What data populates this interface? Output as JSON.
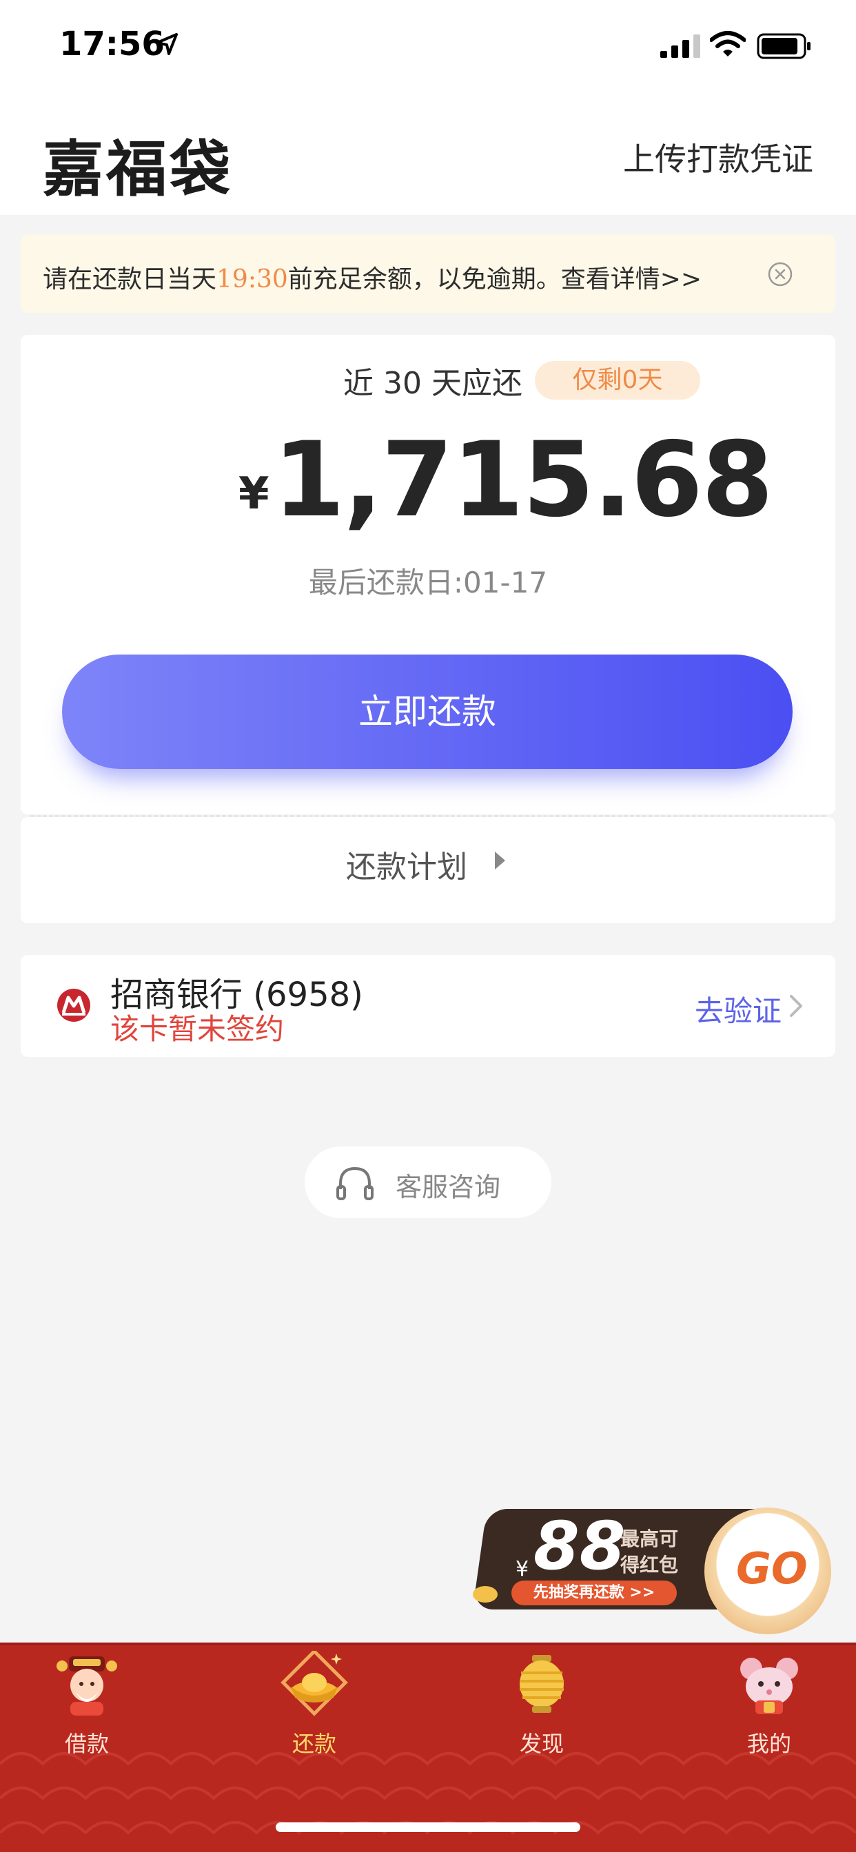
{
  "status_bar": {
    "time": "17:56"
  },
  "header": {
    "title": "嘉福袋",
    "upload_link": "上传打款凭证"
  },
  "notice": {
    "text_before": "请在还款日当天",
    "highlight_time": "19:30",
    "text_after": "前充足余额，以免逾期。查看详情>>"
  },
  "repayment": {
    "due_label": "近 30 天应还",
    "remaining_badge": "仅剩0天",
    "currency_symbol": "¥",
    "amount": "1,715.68",
    "last_date": "最后还款日:01-17",
    "pay_button": "立即还款",
    "plan_link": "还款计划"
  },
  "bank": {
    "name": "招商银行 (6958)",
    "status": "该卡暂未签约",
    "verify_link": "去验证"
  },
  "customer_service": {
    "label": "客服咨询"
  },
  "promo": {
    "currency": "¥",
    "amount": "88",
    "line1": "最高可",
    "line2": "得红包",
    "cta": "先抽奖再还款 >>",
    "go": "GO"
  },
  "tabbar": {
    "items": [
      {
        "label": "借款",
        "icon": "fortune-god-icon"
      },
      {
        "label": "还款",
        "icon": "gold-ingot-icon",
        "active": true
      },
      {
        "label": "发现",
        "icon": "lantern-icon"
      },
      {
        "label": "我的",
        "icon": "mouse-mascot-icon"
      }
    ]
  },
  "colors": {
    "accent_start": "#7e84f8",
    "accent_end": "#4b4ff2",
    "warning_orange": "#ef8b47",
    "error_red": "#e0453c",
    "tabbar_red": "#b9281f",
    "link_blue": "#5c63e8"
  }
}
